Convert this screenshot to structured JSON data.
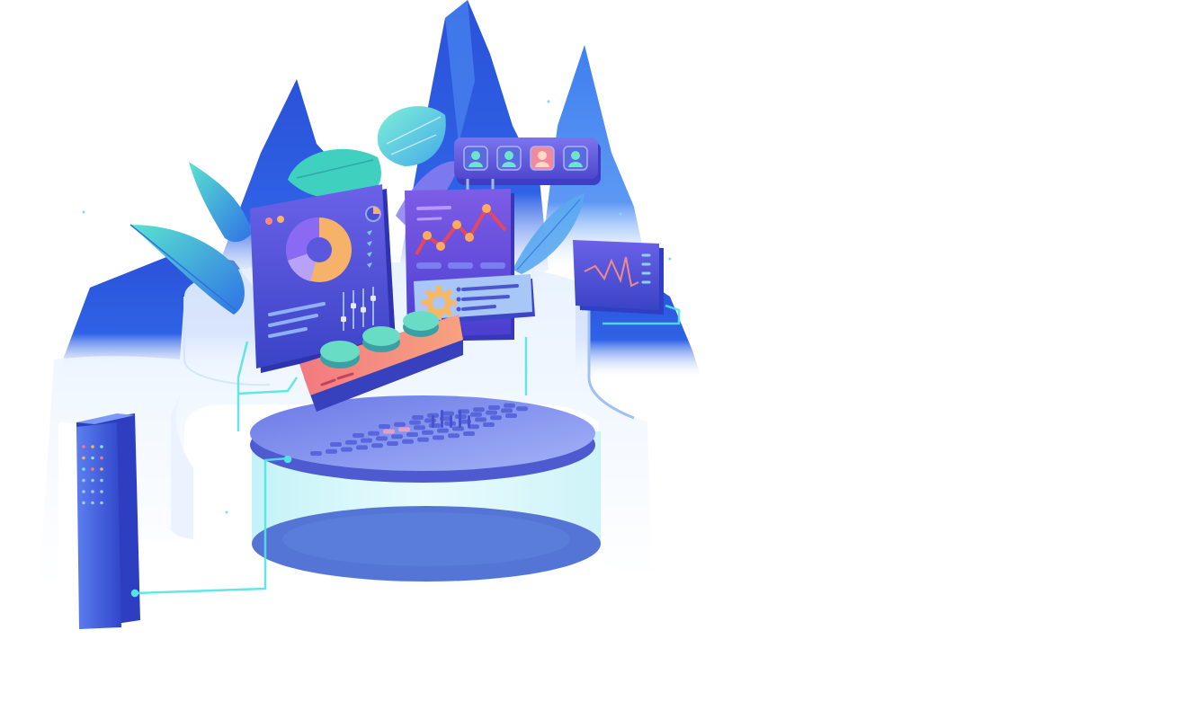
{
  "colors": {
    "background": "#ffffff",
    "mountain_dark": "#1f44c9",
    "mountain_mid": "#2f62e6",
    "mountain_light": "#4a8cf2",
    "mist": "#e8f3ff",
    "platform_top": "#7d86ec",
    "platform_base": "#5475d6",
    "glass": "#d7f8fb",
    "cyan_line": "#52e3e4",
    "panel_purple": "#5a4fd6",
    "donut_orange": "#f7b26a",
    "donut_purple": "#8a6af2",
    "chart_red": "#e4475f",
    "chart_dot": "#ffab5e",
    "knob": "#69dcc6",
    "control_panel": "#f17b7d",
    "leaf_teal": "#4fd6c9",
    "leaf_blue": "#3b73ea",
    "gear": "#f6b866"
  },
  "icons": [
    "donut-chart",
    "line-chart",
    "user-avatar",
    "gear-icon",
    "knob",
    "slider",
    "server-tower",
    "keyboard-pad",
    "palm-leaf"
  ],
  "user_avatars": {
    "count": 4,
    "highlighted_index": 2
  },
  "sliders": {
    "count": 4,
    "levels": [
      0.3,
      0.6,
      0.45,
      0.7
    ]
  }
}
